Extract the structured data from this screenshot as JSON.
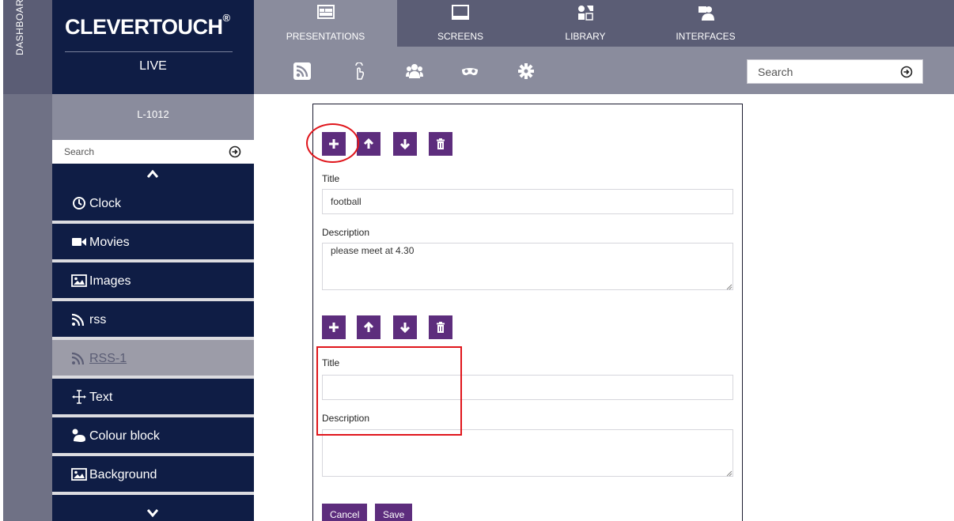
{
  "sidebar_strip": {
    "label": "DASHBOARD"
  },
  "brand": {
    "name": "CLEVERTOUCH",
    "mark": "®",
    "subtitle": "LIVE"
  },
  "top_tabs": [
    {
      "label": "PRESENTATIONS",
      "icon": "presentation-icon",
      "active": true
    },
    {
      "label": "SCREENS",
      "icon": "monitor-icon",
      "active": false
    },
    {
      "label": "LIBRARY",
      "icon": "media-library-icon",
      "active": false
    },
    {
      "label": "INTERFACES",
      "icon": "interface-user-icon",
      "active": false
    }
  ],
  "subbar": {
    "icons": [
      "rss-icon",
      "touch-icon",
      "users-icon",
      "mask-icon",
      "gear-icon"
    ],
    "search_placeholder": "Search"
  },
  "left_panel": {
    "title": "L-1012",
    "search_placeholder": "Search",
    "items": [
      {
        "label": "Clock",
        "icon": "clock-icon"
      },
      {
        "label": "Movies",
        "icon": "video-camera-icon"
      },
      {
        "label": "Images",
        "icon": "image-icon"
      },
      {
        "label": "rss",
        "icon": "rss-icon"
      },
      {
        "label": "RSS-1",
        "icon": "rss-icon",
        "selected": true
      },
      {
        "label": "Text",
        "icon": "text-cursor-icon"
      },
      {
        "label": "Colour block",
        "icon": "paint-icon"
      },
      {
        "label": "Background",
        "icon": "image-icon"
      }
    ]
  },
  "form": {
    "entry1": {
      "title_label": "Title",
      "title_value": "football",
      "description_label": "Description",
      "description_value": "please meet at 4.30"
    },
    "entry2": {
      "title_label": "Title",
      "title_value": "",
      "description_label": "Description",
      "description_value": ""
    },
    "cancel_label": "Cancel",
    "save_label": "Save"
  },
  "colors": {
    "navy": "#0f1d45",
    "slate": "#5b5d75",
    "grey_bar": "#8a8c9d",
    "purple_button": "#5d2d7d",
    "annotation_red": "#e0161c"
  }
}
